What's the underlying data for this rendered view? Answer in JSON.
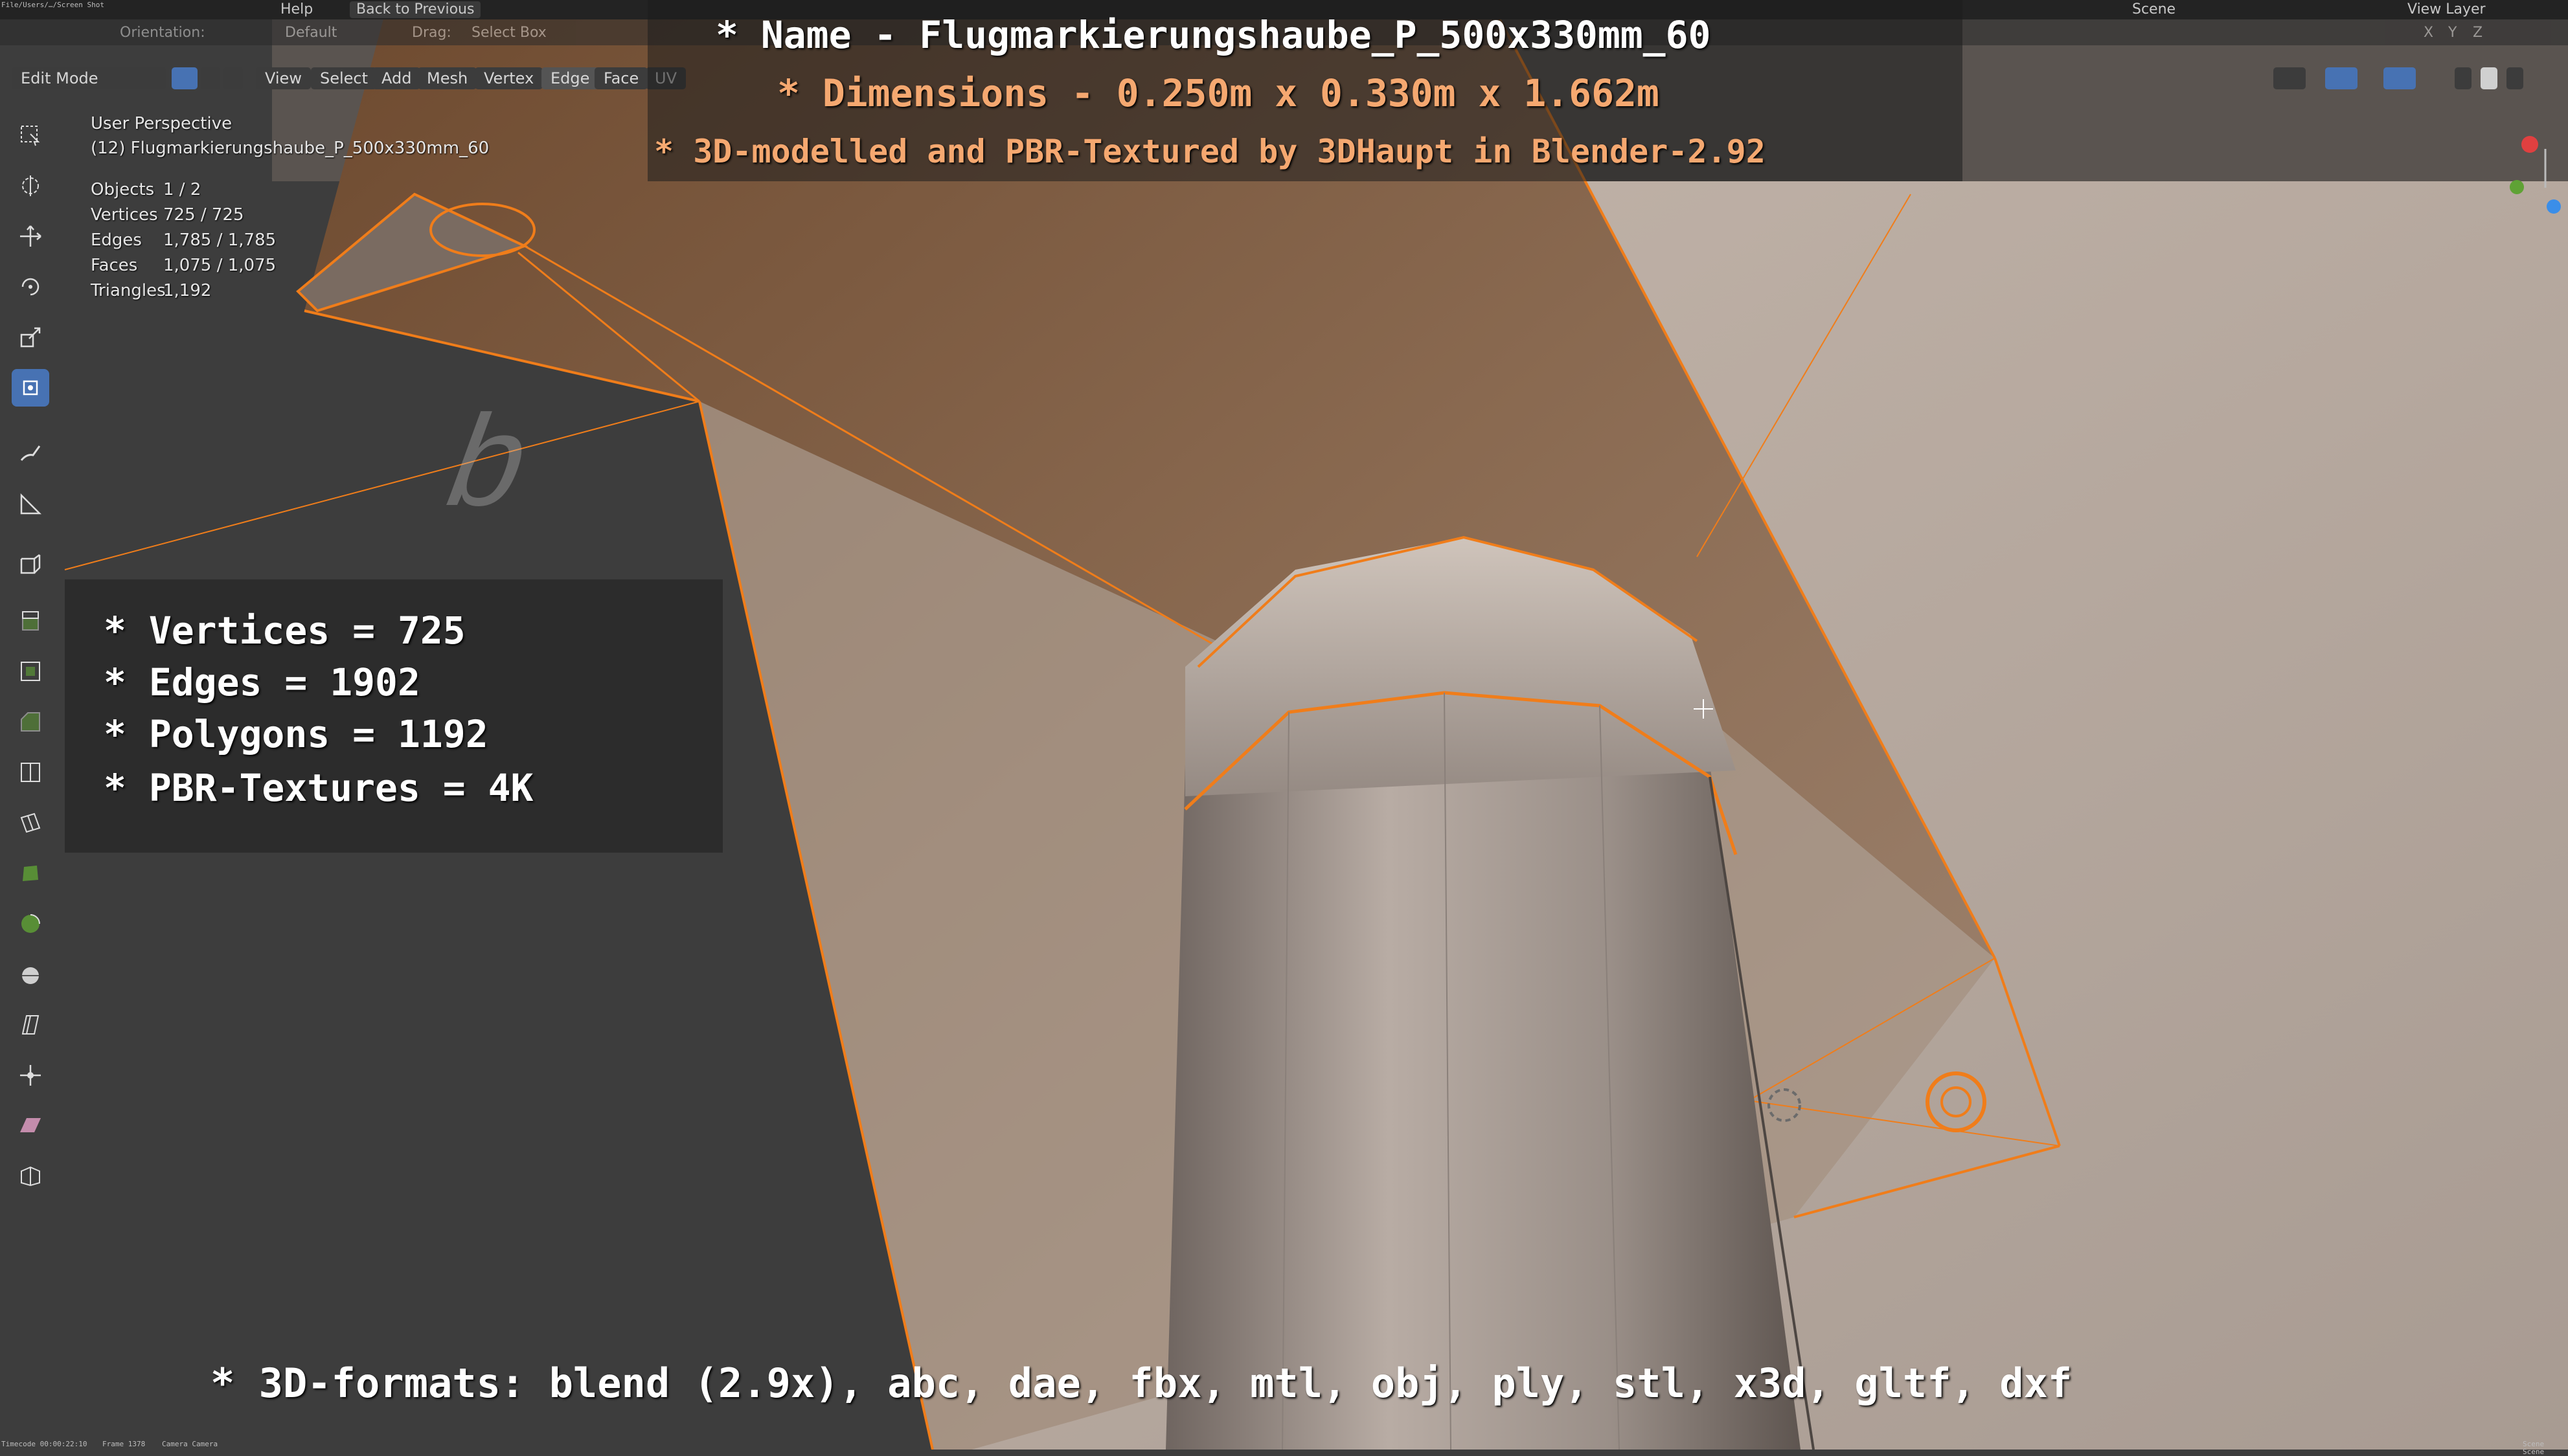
{
  "colors": {
    "accent": "#4772b3",
    "selection": "#f07d1a",
    "bg_dark": "#3d3d3d",
    "panel": "#232323"
  },
  "topbar": {
    "menu": [
      "Help"
    ],
    "back_button": "Back to Previous",
    "scene_label": "Scene",
    "view_layer_label": "View Layer"
  },
  "header": {
    "orientation_label": "Orientation:",
    "transform_value": "Default",
    "drag_label": "Drag:",
    "drag_value": "Select Box",
    "mode_value": "Edit Mode",
    "menu_items": [
      "View",
      "Select",
      "Add",
      "Mesh",
      "Vertex",
      "Edge",
      "Face",
      "UV"
    ],
    "active_item": "Edge",
    "axes": [
      "X",
      "Y",
      "Z"
    ]
  },
  "viewport_info": {
    "perspective": "User Perspective",
    "object": "(12) Flugmarkierungshaube_P_500x330mm_60",
    "stats": [
      {
        "label": "Objects",
        "value": "1 / 2"
      },
      {
        "label": "Vertices",
        "value": "725 / 725"
      },
      {
        "label": "Edges",
        "value": "1,785 / 1,785"
      },
      {
        "label": "Faces",
        "value": "1,075 / 1,075"
      },
      {
        "label": "Triangles",
        "value": "1,192"
      }
    ]
  },
  "overlay": {
    "name_line": "* Name - Flugmarkierungshaube_P_500x330mm_60",
    "dimensions_line": "* Dimensions -  0.250m x 0.330m x 1.662m",
    "credit_line": "* 3D-modelled and PBR-Textured by 3DHaupt in Blender-2.92",
    "specs": [
      "* Vertices = 725",
      "* Edges = 1902",
      "* Polygons = 1192",
      "* PBR-Textures = 4K"
    ],
    "formats_line": "* 3D-formats: blend (2.9x), abc, dae, fbx, mtl, obj, ply, stl, x3d, gltf, dxf"
  },
  "statusbar": {
    "timecode": "Timecode 00:00:22:10",
    "frame": "Frame 1378",
    "camera": "Camera Camera",
    "right": "Scene Scene"
  },
  "tools": [
    "select-box",
    "cursor",
    "move",
    "rotate",
    "scale",
    "transform",
    "annotate",
    "measure",
    "add-cube",
    "extrude",
    "inset",
    "bevel",
    "loop-cut",
    "knife",
    "poly-build",
    "spin",
    "smooth",
    "randomize",
    "edge-slide",
    "shrink-fatten",
    "shear",
    "rip"
  ]
}
